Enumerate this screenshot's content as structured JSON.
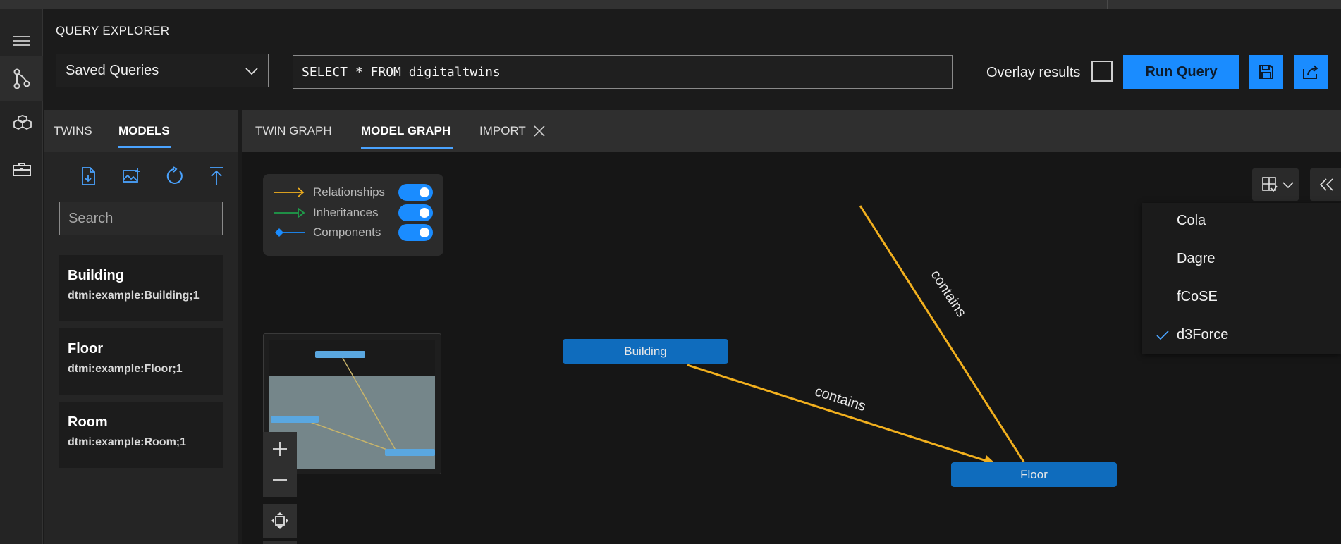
{
  "query_explorer": {
    "title": "QUERY EXPLORER",
    "saved_queries_label": "Saved Queries",
    "query_text": "SELECT * FROM digitaltwins",
    "overlay_label": "Overlay results",
    "overlay_checked": false,
    "run_label": "Run Query"
  },
  "left_panel": {
    "tabs": [
      "TWINS",
      "MODELS"
    ],
    "active_tab": "MODELS",
    "search_placeholder": "Search",
    "models": [
      {
        "name": "Building",
        "id": "dtmi:example:Building;1"
      },
      {
        "name": "Floor",
        "id": "dtmi:example:Floor;1"
      },
      {
        "name": "Room",
        "id": "dtmi:example:Room;1"
      }
    ]
  },
  "graph_tabs": {
    "tabs": [
      "TWIN GRAPH",
      "MODEL GRAPH",
      "IMPORT"
    ],
    "active_tab": "MODEL GRAPH"
  },
  "legend": {
    "relationships": "Relationships",
    "inheritances": "Inheritances",
    "components": "Components",
    "colors": {
      "relationships": "#f2b01e",
      "inheritances": "#1e9e4a",
      "components": "#1a8cff"
    }
  },
  "graph": {
    "nodes": [
      "Building",
      "Floor"
    ],
    "edge_label": "contains"
  },
  "layout_menu": {
    "items": [
      "Cola",
      "Dagre",
      "fCoSE",
      "d3Force"
    ],
    "selected": "d3Force"
  },
  "colors": {
    "accent": "#1a8cff",
    "node": "#0f6cbd",
    "edge": "#f2b01e"
  }
}
